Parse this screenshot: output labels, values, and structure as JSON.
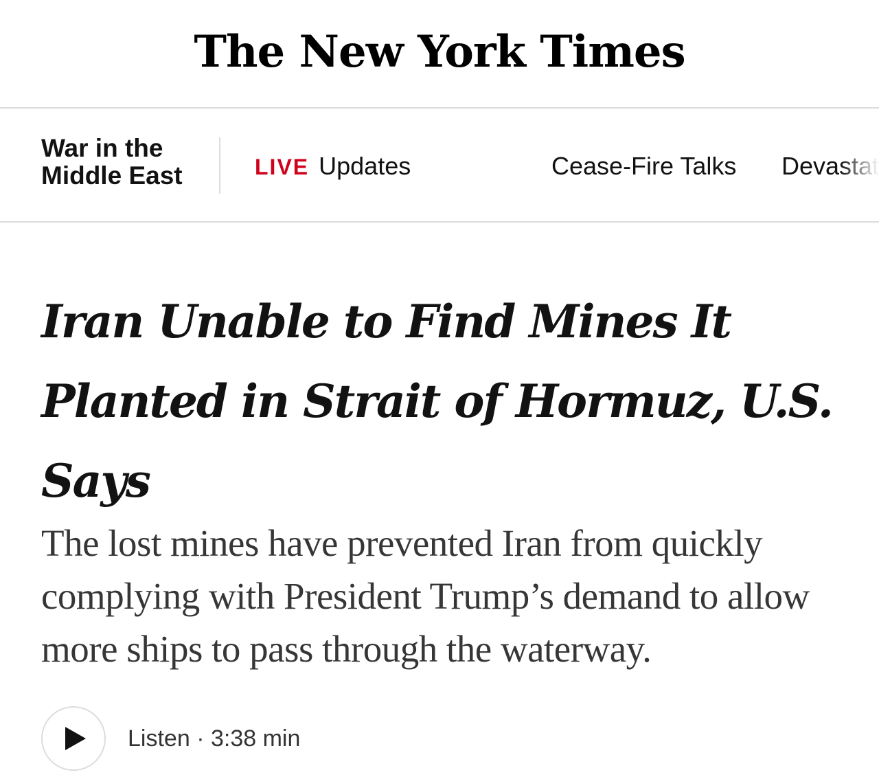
{
  "masthead": {
    "logo_text": "The New York Times"
  },
  "section_nav": {
    "section_title_line1": "War in the",
    "section_title_line2": "Middle East",
    "links": [
      {
        "tag": "LIVE",
        "label": "Updates"
      },
      {
        "label": "Cease-Fire Talks"
      },
      {
        "label": "Devastat"
      }
    ],
    "live_color": "#d0021b"
  },
  "article": {
    "headline": "Iran Unable to Find Mines It Planted in Strait of Hormuz, U.S. Says",
    "summary": "The lost mines have prevented Iran from quickly complying with President Trump’s demand to allow more ships to pass through the waterway."
  },
  "audio": {
    "play_icon": "play-icon",
    "label": "Listen",
    "separator": "·",
    "duration": "3:38 min"
  }
}
